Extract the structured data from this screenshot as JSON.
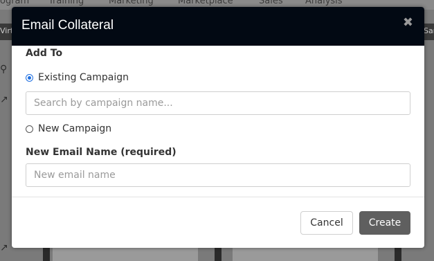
{
  "background": {
    "nav_items": [
      "ogram",
      "Training",
      "Marketing",
      "Marketplace",
      "Sales",
      "Analysis"
    ],
    "strip_left": "Virt",
    "strip_right": "Sar"
  },
  "modal": {
    "title": "Email Collateral",
    "close_icon": "close-icon",
    "add_to_label": "Add To",
    "existing_campaign_label": "Existing Campaign",
    "existing_campaign_selected": true,
    "campaign_search_placeholder": "Search by campaign name...",
    "campaign_search_value": "",
    "new_campaign_label": "New Campaign",
    "email_name_label": "New Email Name (required)",
    "email_name_placeholder": "New email name",
    "email_name_value": "",
    "cancel_label": "Cancel",
    "create_label": "Create"
  },
  "colors": {
    "header_bg": "#020913",
    "create_button": "#5f5f5f",
    "radio_accent": "#1f6fe0"
  }
}
